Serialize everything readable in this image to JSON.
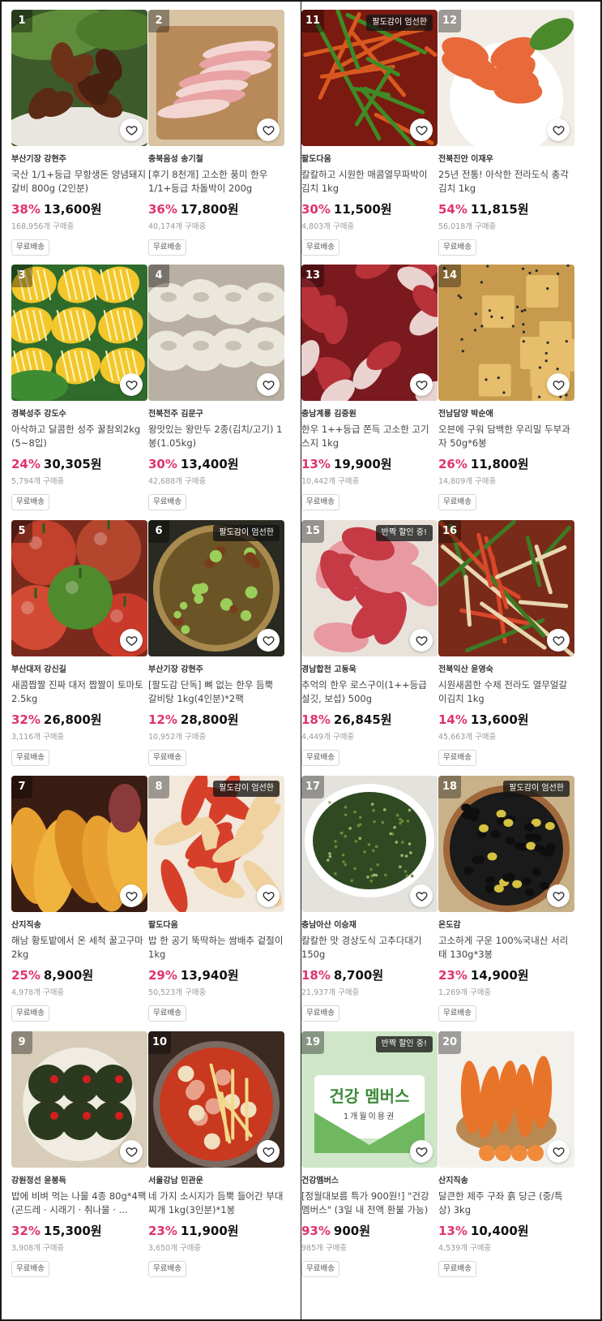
{
  "products": [
    {
      "rank": "1",
      "badge": "",
      "seller": "부산기장 강현주",
      "title": "국산 1/1+등급 무항생돈 양념돼지갈비 800g (2인분)",
      "discount": "38%",
      "price": "13,600원",
      "sold": "168,956개 구매중",
      "shipping": "무료배송",
      "art": "galbi"
    },
    {
      "rank": "2",
      "badge": "",
      "seller": "충북음성 송기철",
      "title": "[후기 8천개] 고소한 풍미 한우 1/1+등급 차돌박이 200g",
      "discount": "36%",
      "price": "17,800원",
      "sold": "40,174개 구매중",
      "shipping": "무료배송",
      "art": "chadol"
    },
    {
      "rank": "3",
      "badge": "",
      "seller": "경북성주 강도수",
      "title": "아삭하고 달콤한 성주 꿀참외2kg (5~8입)",
      "discount": "24%",
      "price": "30,305원",
      "sold": "5,794개 구매중",
      "shipping": "무료배송",
      "art": "melon"
    },
    {
      "rank": "4",
      "badge": "",
      "seller": "전북전주 김문구",
      "title": "왕맛있는 왕만두 2종(김치/고기) 1봉(1.05kg)",
      "discount": "30%",
      "price": "13,400원",
      "sold": "42,688개 구매중",
      "shipping": "무료배송",
      "art": "dumpling"
    },
    {
      "rank": "5",
      "badge": "",
      "seller": "부산대저 강신길",
      "title": "새콤짭짤 진짜 대저 짭짤이 토마토 2.5kg",
      "discount": "32%",
      "price": "26,800원",
      "sold": "3,116개 구매중",
      "shipping": "무료배송",
      "art": "tomato"
    },
    {
      "rank": "6",
      "badge": "팔도감이 엄선한",
      "seller": "부산기장 강현주",
      "title": "[팔도감 단독] 뼈 없는 한우 듬뿍 갈비탕 1kg(4인분)*2팩",
      "discount": "12%",
      "price": "28,800원",
      "sold": "10,952개 구매중",
      "shipping": "무료배송",
      "art": "soup"
    },
    {
      "rank": "7",
      "badge": "",
      "seller": "산지직송",
      "title": "해남 황토밭에서 온 세척 꿀고구마 2kg",
      "discount": "25%",
      "price": "8,900원",
      "sold": "4,978개 구매중",
      "shipping": "무료배송",
      "art": "potato"
    },
    {
      "rank": "8",
      "badge": "팔도감이 엄선한",
      "seller": "팔도다움",
      "title": "밥 한 공기 뚝딱하는 쌈배추 겉절이 1kg",
      "discount": "29%",
      "price": "13,940원",
      "sold": "50,523개 구매중",
      "shipping": "무료배송",
      "art": "cabbage"
    },
    {
      "rank": "9",
      "badge": "",
      "seller": "강원정선 윤봉득",
      "title": "밥에 비벼 먹는 나물 4종 80g*4팩 (곤드레 · 시래기 · 취나물 · ...",
      "discount": "32%",
      "price": "15,300원",
      "sold": "3,908개 구매중",
      "shipping": "무료배송",
      "art": "namul"
    },
    {
      "rank": "10",
      "badge": "",
      "seller": "서울강남 민관운",
      "title": "네 가지 소시지가 듬뿍 들어간 부대찌개 1kg(3인분)*1봉",
      "discount": "23%",
      "price": "11,900원",
      "sold": "3,650개 구매중",
      "shipping": "무료배송",
      "art": "budae"
    },
    {
      "rank": "11",
      "badge": "팔도감이 엄선한",
      "seller": "팔도다움",
      "title": "칼칼하고 시원한 매콤열무파박이 김치 1kg",
      "discount": "30%",
      "price": "11,500원",
      "sold": "4,803개 구매중",
      "shipping": "무료배송",
      "art": "yeolmu"
    },
    {
      "rank": "12",
      "badge": "",
      "seller": "전북진안 이재우",
      "title": "25년 전통! 아삭한 전라도식 총각김치 1kg",
      "discount": "54%",
      "price": "11,815원",
      "sold": "56,018개 구매중",
      "shipping": "무료배송",
      "art": "chonggak"
    },
    {
      "rank": "13",
      "badge": "",
      "seller": "충남계룡 김중원",
      "title": "한우 1++등급 쫀득 고소한 고기스지 1kg",
      "discount": "13%",
      "price": "19,900원",
      "sold": "10,442개 구매중",
      "shipping": "무료배송",
      "art": "suji"
    },
    {
      "rank": "14",
      "badge": "",
      "seller": "전남담양 박순애",
      "title": "오븐에 구워 담백한 우리밀 두부과자 50g*6봉",
      "discount": "26%",
      "price": "11,800원",
      "sold": "14,809개 구매중",
      "shipping": "무료배송",
      "art": "cracker"
    },
    {
      "rank": "15",
      "badge": "반짝 할인 중!",
      "seller": "경남합천 고동욱",
      "title": "추억의 한우 로스구이(1++등급 설깃, 보섭) 500g",
      "discount": "18%",
      "price": "26,845원",
      "sold": "4,449개 구매중",
      "shipping": "무료배송",
      "art": "beef"
    },
    {
      "rank": "16",
      "badge": "",
      "seller": "전북익산 윤영숙",
      "title": "시원새콤한 수제 전라도 열무얼갈이김치 1kg",
      "discount": "14%",
      "price": "13,600원",
      "sold": "45,663개 구매중",
      "shipping": "무료배송",
      "art": "kimchi2"
    },
    {
      "rank": "17",
      "badge": "",
      "seller": "충남아산 이승재",
      "title": "칼칼한 맛 경상도식 고추다대기 150g",
      "discount": "18%",
      "price": "8,700원",
      "sold": "21,937개 구매중",
      "shipping": "무료배송",
      "art": "dadaegi"
    },
    {
      "rank": "18",
      "badge": "팔도감이 엄선한",
      "seller": "온도감",
      "title": "고소하게 구운 100%국내산 서리태 130g*3봉",
      "discount": "23%",
      "price": "14,900원",
      "sold": "1,269개 구매중",
      "shipping": "무료배송",
      "art": "beans"
    },
    {
      "rank": "19",
      "badge": "반짝 할인 중!",
      "seller": "건강멤버스",
      "title": "[정월대보름 특가 900원!] \"건강멤버스\" (3일 내 전액 환불 가능)",
      "discount": "93%",
      "price": "900원",
      "sold": "985개 구매중",
      "shipping": "무료배송",
      "art": "member",
      "card_title": "건강 멤버스",
      "card_sub": "1개월이용권"
    },
    {
      "rank": "20",
      "badge": "",
      "seller": "산지직송",
      "title": "달큰한 제주 구좌 흙 당근 (중/특상) 3kg",
      "discount": "13%",
      "price": "10,400원",
      "sold": "4,539개 구매중",
      "shipping": "무료배송",
      "art": "carrot"
    }
  ]
}
